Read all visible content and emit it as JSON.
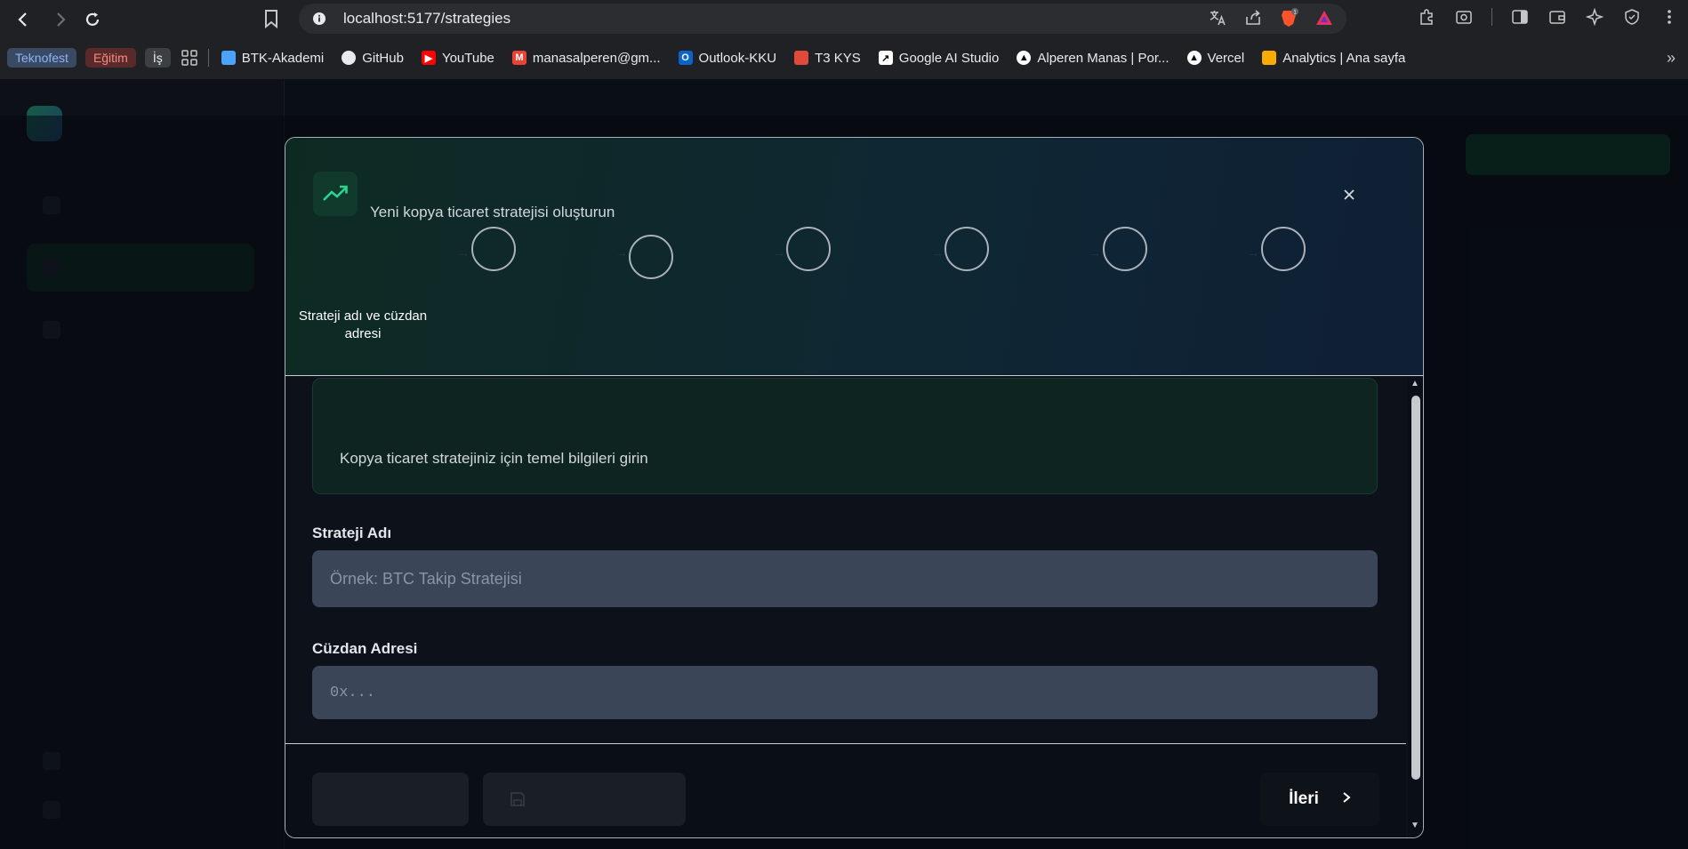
{
  "browser": {
    "url": "localhost:5177/strategies",
    "bookmark_chips": [
      "Teknofest",
      "Eğitim",
      "İş"
    ],
    "bookmarks": [
      {
        "label": "BTK-Akademi",
        "icon": "btk-icon",
        "color": "#4aa3ff"
      },
      {
        "label": "GitHub",
        "icon": "github-icon",
        "color": "#e8eaed"
      },
      {
        "label": "YouTube",
        "icon": "youtube-icon",
        "color": "#ff0000"
      },
      {
        "label": "manasalperen@gm...",
        "icon": "gmail-icon",
        "color": "#ea4335"
      },
      {
        "label": "Outlook-KKU",
        "icon": "outlook-icon",
        "color": "#0a64c8"
      },
      {
        "label": "T3 KYS",
        "icon": "t3-icon",
        "color": "#e04a3a"
      },
      {
        "label": "Google AI Studio",
        "icon": "ai-studio-icon",
        "color": "#ffffff"
      },
      {
        "label": "Alperen Manas | Por...",
        "icon": "vercel-icon",
        "color": "#ffffff"
      },
      {
        "label": "Vercel",
        "icon": "vercel-icon",
        "color": "#ffffff"
      },
      {
        "label": "Analytics | Ana sayfa",
        "icon": "analytics-icon",
        "color": "#f9ab00"
      }
    ]
  },
  "modal": {
    "subtitle": "Yeni kopya ticaret stratejisi oluşturun",
    "steps": [
      {
        "description": "Strateji adı ve cüzdan adresi",
        "active": true
      }
    ],
    "info_description": "Kopya ticaret stratejiniz için temel bilgileri girin",
    "strategy_name_label": "Strateji Adı",
    "strategy_name_placeholder": "Örnek: BTC Takip Stratejisi",
    "wallet_label": "Cüzdan Adresi",
    "wallet_placeholder": "0x...",
    "next_label": "İleri"
  },
  "colors": {
    "accent": "#1fb97a",
    "field_bg": "#3a4557"
  }
}
